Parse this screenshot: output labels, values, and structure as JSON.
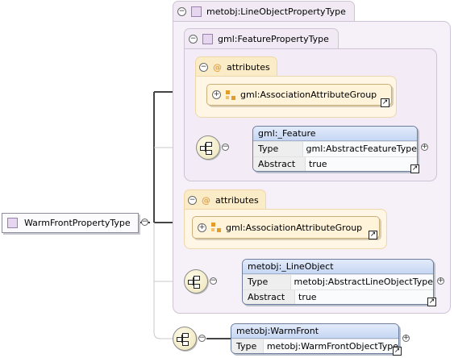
{
  "root": {
    "label": "WarmFrontPropertyType"
  },
  "outer_type": {
    "label": "metobj:LineObjectPropertyType"
  },
  "inner_type": {
    "label": "gml:FeaturePropertyType"
  },
  "attributes_label": "attributes",
  "association_group": "gml:AssociationAttributeGroup",
  "feature_element": {
    "title": "gml:_Feature",
    "type_key": "Type",
    "type_value": "gml:AbstractFeatureType",
    "abstract_key": "Abstract",
    "abstract_value": "true"
  },
  "line_object_element": {
    "title": "metobj:_LineObject",
    "type_key": "Type",
    "type_value": "metobj:AbstractLineObjectType",
    "abstract_key": "Abstract",
    "abstract_value": "true"
  },
  "warm_front_element": {
    "title": "metobj:WarmFront",
    "type_key": "Type",
    "type_value": "metobj:WarmFrontObjectType"
  },
  "icons": {
    "collapse": "minus-circle-icon",
    "expand": "plus-circle-icon",
    "complex_type": "complex-type-icon",
    "attributes": "at-sign-icon",
    "attribute_group": "attribute-group-icon",
    "sequence": "sequence-icon",
    "reference": "reference-arrow-icon"
  },
  "colors": {
    "type_fill": "#f6f1f8",
    "attr_fill": "#fff6e6",
    "element_header": "#c7d7f3"
  }
}
